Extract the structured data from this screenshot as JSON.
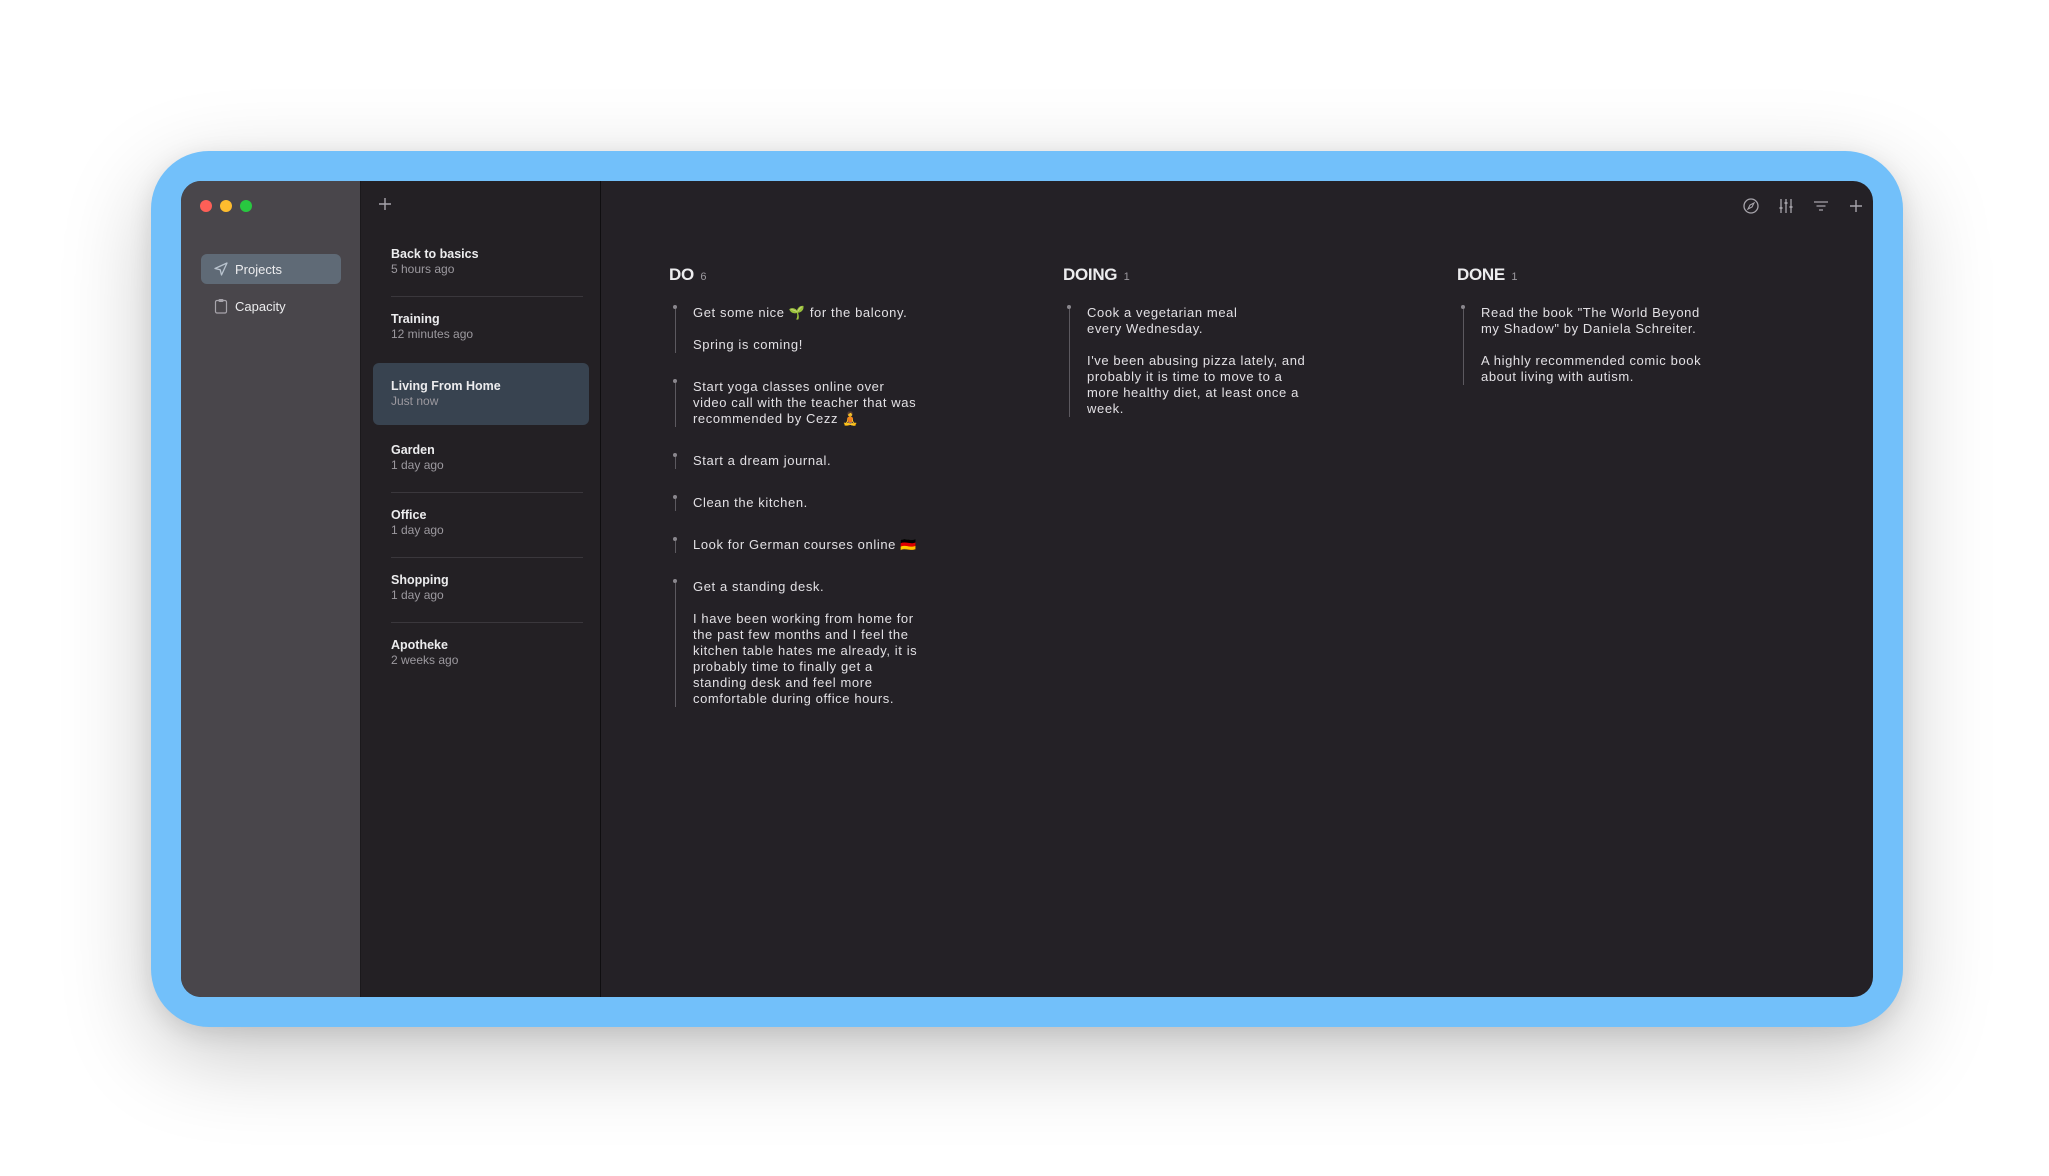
{
  "sidebar": {
    "items": [
      {
        "label": "Projects",
        "icon": "paper-plane-icon",
        "active": true
      },
      {
        "label": "Capacity",
        "icon": "clipboard-icon",
        "active": false
      }
    ]
  },
  "projects": [
    {
      "name": "Back to basics",
      "time": "5 hours ago"
    },
    {
      "name": "Training",
      "time": "12 minutes ago"
    },
    {
      "name": "Living From Home",
      "time": "Just now",
      "active": true
    },
    {
      "name": "Garden",
      "time": "1 day ago"
    },
    {
      "name": "Office",
      "time": "1 day ago"
    },
    {
      "name": "Shopping",
      "time": "1 day ago"
    },
    {
      "name": "Apotheke",
      "time": "2 weeks ago"
    }
  ],
  "toolbar": {
    "icons": [
      "compass-icon",
      "sliders-icon",
      "filter-icon",
      "add-icon"
    ]
  },
  "board": {
    "columns": [
      {
        "title": "DO",
        "count": "6",
        "cards": [
          {
            "title": "Get some nice 🌱 for the balcony.",
            "body": "Spring is coming!"
          },
          {
            "title": "Start yoga classes online over\nvideo call with the teacher that was\nrecommended by Cezz 🧘",
            "body": ""
          },
          {
            "title": "Start a dream journal.",
            "body": ""
          },
          {
            "title": "Clean the kitchen.",
            "body": ""
          },
          {
            "title": "Look for German courses online 🇩🇪",
            "body": ""
          },
          {
            "title": "Get a standing desk.",
            "body": "I have been working from home for\nthe past few months and I feel the\nkitchen table hates me already, it is\nprobably time to finally get a\nstanding desk and feel more\ncomfortable during office hours."
          }
        ]
      },
      {
        "title": "DOING",
        "count": "1",
        "cards": [
          {
            "title": "Cook a vegetarian meal\nevery Wednesday.",
            "body": "I've been abusing pizza lately, and\nprobably it is time to move to a\nmore healthy diet, at least once a\nweek."
          }
        ]
      },
      {
        "title": "DONE",
        "count": "1",
        "cards": [
          {
            "title": "Read the book \"The World Beyond\nmy Shadow\" by Daniela Schreiter.",
            "body": "A highly recommended comic book\nabout living with autism."
          }
        ]
      }
    ]
  },
  "colors": {
    "frame": "#72c0fa",
    "window": "#242126",
    "sidebar": "#49464b",
    "active_nav": "#5f6a76",
    "active_project": "#384350"
  }
}
